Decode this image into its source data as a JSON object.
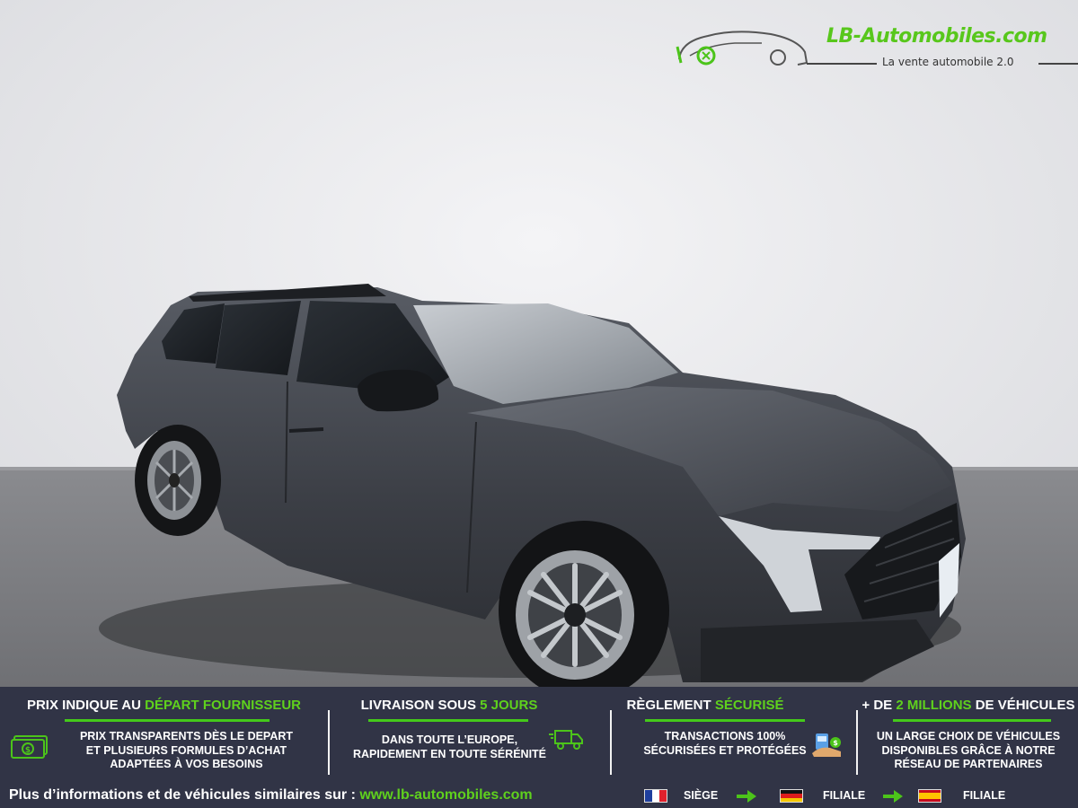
{
  "logo": {
    "name": "LB-Automobiles.com",
    "tagline": "La vente automobile 2.0"
  },
  "banner": {
    "columns": [
      {
        "title_plain": "PRIX INDIQUE AU ",
        "title_accent": "DÉPART FOURNISSEUR",
        "title_after": "",
        "lines": [
          "PRIX TRANSPARENTS DÈS LE DEPART",
          "ET PLUSIEURS FORMULES D’ACHAT",
          "ADAPTÉES À VOS BESOINS"
        ],
        "icon": "money-icon"
      },
      {
        "title_plain": "LIVRAISON SOUS ",
        "title_accent": "5 JOURS",
        "title_after": "",
        "lines": [
          "DANS TOUTE L’EUROPE,",
          "RAPIDEMENT EN TOUTE SÉRÉNITÉ"
        ],
        "icon": "delivery-truck-icon"
      },
      {
        "title_plain": "RÈGLEMENT ",
        "title_accent": "SÉCURISÉ",
        "title_after": "",
        "lines": [
          "TRANSACTIONS 100%",
          "SÉCURISÉES ET PROTÉGÉES"
        ],
        "icon": "secure-payment-icon"
      },
      {
        "title_plain": "+ DE ",
        "title_accent": "2 MILLIONS",
        "title_after": " DE VÉHICULES",
        "lines": [
          "UN LARGE CHOIX DE VÉHICULES",
          "DISPONIBLES GRÂCE À NOTRE",
          "RÉSEAU DE PARTENAIRES"
        ],
        "icon": ""
      }
    ],
    "footer": {
      "more_text": "Plus d’informations et de véhicules similaires sur : ",
      "url": "www.lb-automobiles.com",
      "locations": [
        {
          "flag": "france-flag-icon",
          "label": "SIÈGE"
        },
        {
          "flag": "germany-flag-icon",
          "label": "FILIALE"
        },
        {
          "flag": "spain-flag-icon",
          "label": "FILIALE"
        }
      ]
    }
  },
  "colors": {
    "brand_green": "#5fd11d",
    "banner_bg": "#313446",
    "car_body": "#3d4047"
  }
}
